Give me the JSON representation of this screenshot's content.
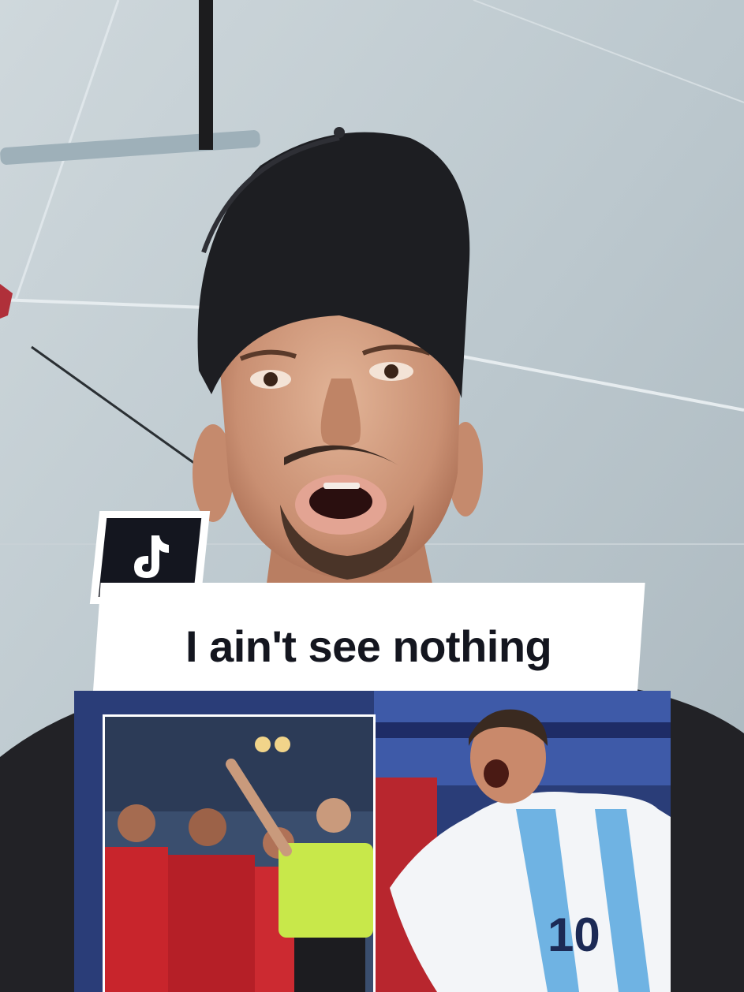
{
  "caption": {
    "text": "I ain't see nothing"
  },
  "logo": {
    "icon": "tiktok-note-icon",
    "bg_color": "#14161f"
  },
  "scene": {
    "description_icon": "umbrella-canopy"
  }
}
